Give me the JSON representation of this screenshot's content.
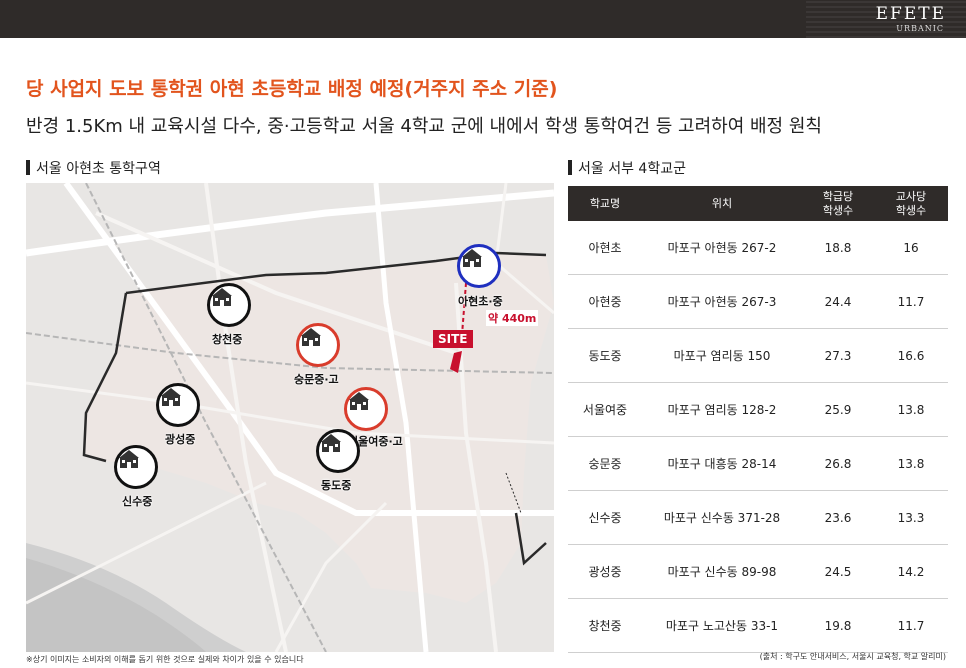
{
  "brand": {
    "name": "EFETE",
    "sub": "URBANIC"
  },
  "headline": "당 사업지 도보 통학권 아현 초등학교 배정 예정(거주지 주소 기준)",
  "subhead": "반경 1.5Km 내 교육시설 다수,  중·고등학교 서울 4학교 군에 내에서 학생 통학여건 등 고려하여 배정 원칙",
  "map_section_title": "서울 아현초 통학구역",
  "table_section_title": "서울 서부 4학교군",
  "map": {
    "site_label": "SITE",
    "distance_label": "약 440m",
    "schools": [
      {
        "name": "창천중",
        "ring": "black"
      },
      {
        "name": "광성중",
        "ring": "black"
      },
      {
        "name": "신수중",
        "ring": "black"
      },
      {
        "name": "숭문중·고",
        "ring": "red"
      },
      {
        "name": "서울여중·고",
        "ring": "red"
      },
      {
        "name": "동도중",
        "ring": "black"
      },
      {
        "name": "아현초·중",
        "ring": "blue"
      }
    ],
    "colors": {
      "black_ring": "#111111",
      "red_ring": "#d93c2c",
      "blue_ring": "#1f2fbf",
      "site": "#c8102e"
    }
  },
  "table": {
    "headers": [
      "학교명",
      "위치",
      "학급당\n학생수",
      "교사당\n학생수"
    ],
    "rows": [
      [
        "아현초",
        "마포구 아현동 267-2",
        "18.8",
        "16"
      ],
      [
        "아현중",
        "마포구 아현동 267-3",
        "24.4",
        "11.7"
      ],
      [
        "동도중",
        "마포구 염리동 150",
        "27.3",
        "16.6"
      ],
      [
        "서울여중",
        "마포구 염리동 128-2",
        "25.9",
        "13.8"
      ],
      [
        "숭문중",
        "마포구 대흥동 28-14",
        "26.8",
        "13.8"
      ],
      [
        "신수중",
        "마포구 신수동 371-28",
        "23.6",
        "13.3"
      ],
      [
        "광성중",
        "마포구 신수동 89-98",
        "24.5",
        "14.2"
      ],
      [
        "창천중",
        "마포구 노고산동 33-1",
        "19.8",
        "11.7"
      ]
    ]
  },
  "footnote": "※상기 이미지는 소비자의 이해를 돕기 위한 것으로 실제와 차이가 있을 수 있습니다",
  "source": "(출처 : 학구도 안내서비스, 서울시 교육청, 학교 알리미)"
}
